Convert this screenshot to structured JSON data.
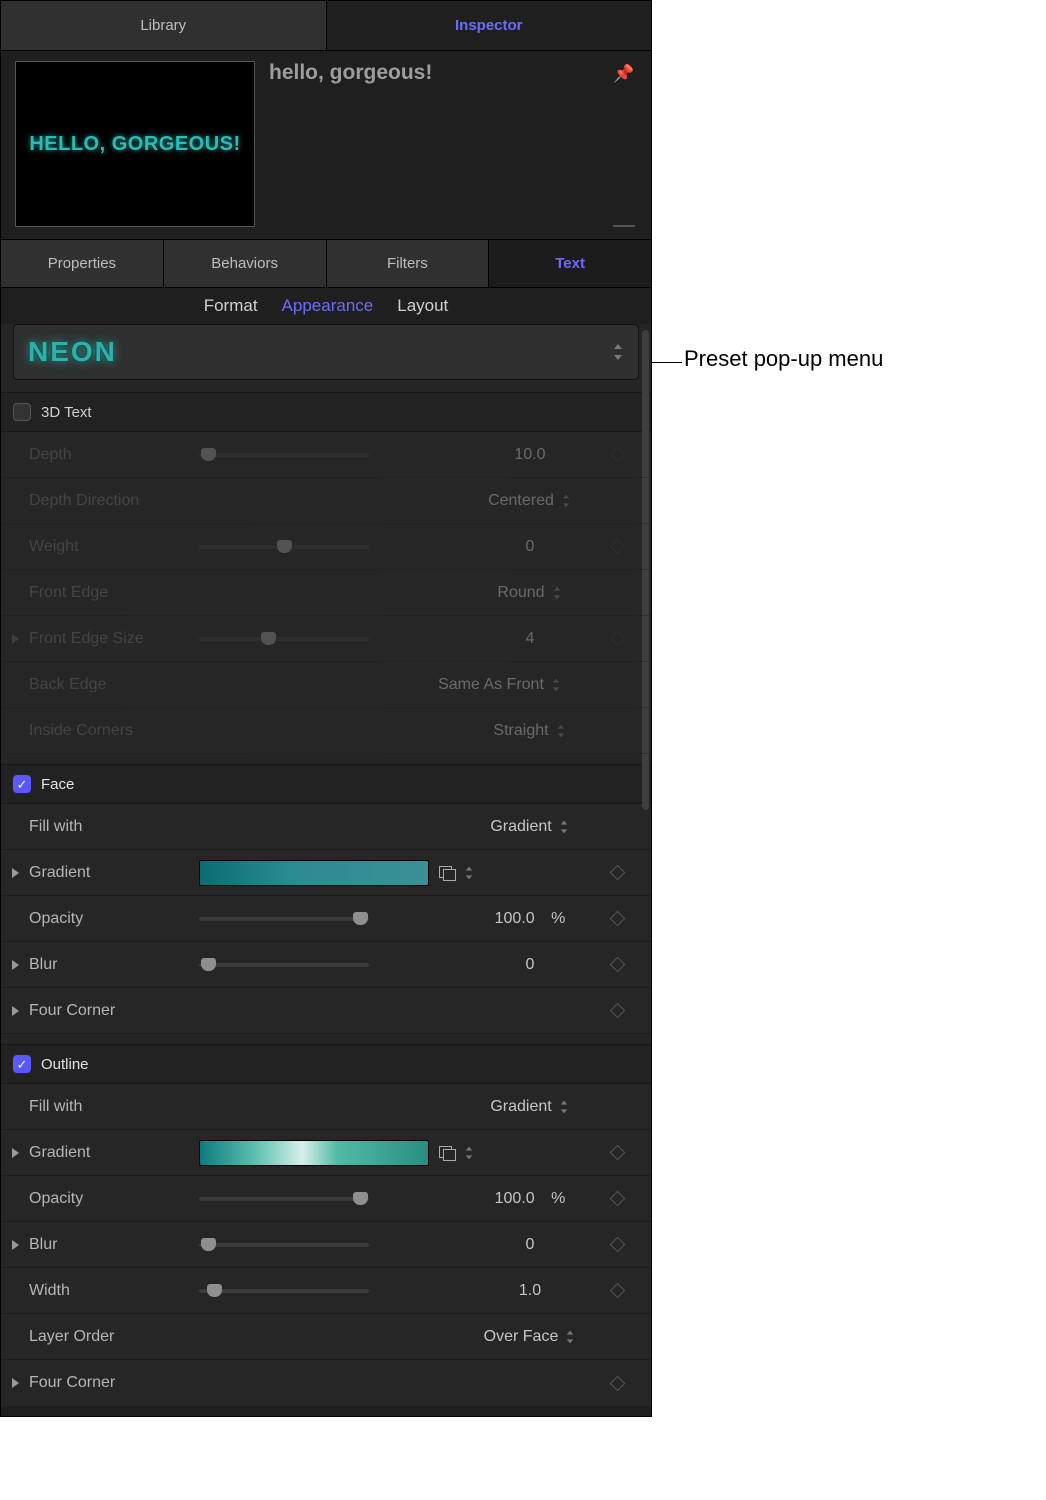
{
  "topTabs": {
    "library": "Library",
    "inspector": "Inspector"
  },
  "preview": {
    "thumbText": "HELLO, GORGEOUS!",
    "title": "hello, gorgeous!"
  },
  "sectionTabs": {
    "properties": "Properties",
    "behaviors": "Behaviors",
    "filters": "Filters",
    "text": "Text"
  },
  "subTabs": {
    "format": "Format",
    "appearance": "Appearance",
    "layout": "Layout"
  },
  "preset": {
    "label": "NEON"
  },
  "threeD": {
    "title": "3D Text",
    "depth": {
      "label": "Depth",
      "value": "10.0"
    },
    "depthDirection": {
      "label": "Depth Direction",
      "value": "Centered"
    },
    "weight": {
      "label": "Weight",
      "value": "0"
    },
    "frontEdge": {
      "label": "Front Edge",
      "value": "Round"
    },
    "frontEdgeSize": {
      "label": "Front Edge Size",
      "value": "4"
    },
    "backEdge": {
      "label": "Back Edge",
      "value": "Same As Front"
    },
    "insideCorners": {
      "label": "Inside Corners",
      "value": "Straight"
    }
  },
  "face": {
    "title": "Face",
    "fillWith": {
      "label": "Fill with",
      "value": "Gradient"
    },
    "gradient": {
      "label": "Gradient"
    },
    "opacity": {
      "label": "Opacity",
      "value": "100.0",
      "unit": "%"
    },
    "blur": {
      "label": "Blur",
      "value": "0"
    },
    "fourCorner": {
      "label": "Four Corner"
    }
  },
  "outline": {
    "title": "Outline",
    "fillWith": {
      "label": "Fill with",
      "value": "Gradient"
    },
    "gradient": {
      "label": "Gradient"
    },
    "opacity": {
      "label": "Opacity",
      "value": "100.0",
      "unit": "%"
    },
    "blur": {
      "label": "Blur",
      "value": "0"
    },
    "width": {
      "label": "Width",
      "value": "1.0"
    },
    "layerOrder": {
      "label": "Layer Order",
      "value": "Over Face"
    },
    "fourCorner": {
      "label": "Four Corner"
    }
  },
  "callout": "Preset pop-up menu"
}
